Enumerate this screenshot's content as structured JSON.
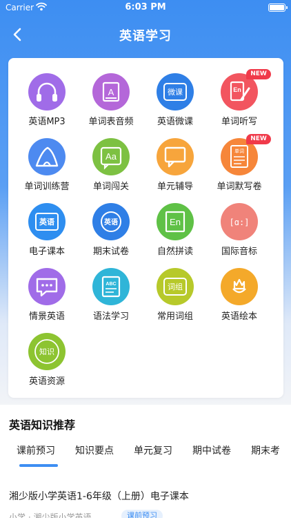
{
  "status_bar": {
    "carrier": "Carrier",
    "time": "6:03 PM"
  },
  "nav": {
    "title": "英语学习"
  },
  "features": [
    {
      "label": "英语MP3",
      "icon": "headphones-icon",
      "color": "#a06ce8",
      "badge": ""
    },
    {
      "label": "单词表音频",
      "icon": "letter-a-book-icon",
      "color": "#b467d9",
      "badge": ""
    },
    {
      "label": "英语微课",
      "icon": "micro-course-icon",
      "color": "#2f7fe6",
      "badge": "",
      "icon_text": "微课"
    },
    {
      "label": "单词听写",
      "icon": "dictation-icon",
      "color": "#f2555f",
      "badge": "NEW"
    },
    {
      "label": "单词训练营",
      "icon": "tent-icon",
      "color": "#4d8af0",
      "badge": ""
    },
    {
      "label": "单词闯关",
      "icon": "aa-icon",
      "color": "#7dc142",
      "badge": "",
      "icon_text": "Aa"
    },
    {
      "label": "单元辅导",
      "icon": "chat-bubble-icon",
      "color": "#f7a53c",
      "badge": ""
    },
    {
      "label": "单词默写卷",
      "icon": "test-paper-icon",
      "color": "#f6863a",
      "badge": "NEW",
      "icon_text": "单词"
    },
    {
      "label": "电子课本",
      "icon": "ebook-icon",
      "color": "#2e8ef0",
      "badge": "",
      "icon_text": "英语"
    },
    {
      "label": "期末试卷",
      "icon": "exam-icon",
      "color": "#2f7fe6",
      "badge": "",
      "icon_text": "英语"
    },
    {
      "label": "自然拼读",
      "icon": "phonics-icon",
      "color": "#5fc146",
      "badge": "",
      "icon_text": "En"
    },
    {
      "label": "国际音标",
      "icon": "phonetic-icon",
      "color": "#f0837a",
      "badge": "",
      "icon_text": "[ɑ:]"
    },
    {
      "label": "情景英语",
      "icon": "dialog-icon",
      "color": "#a06ce8",
      "badge": ""
    },
    {
      "label": "语法学习",
      "icon": "grammar-icon",
      "color": "#2fb5d8",
      "badge": "",
      "icon_text": "ABC"
    },
    {
      "label": "常用词组",
      "icon": "phrase-icon",
      "color": "#b7c92a",
      "badge": "",
      "icon_text": "词组"
    },
    {
      "label": "英语绘本",
      "icon": "picture-book-icon",
      "color": "#f4a92a",
      "badge": ""
    },
    {
      "label": "英语资源",
      "icon": "knowledge-icon",
      "color": "#8dc431",
      "badge": "",
      "icon_text": "知识"
    }
  ],
  "recommend": {
    "title": "英语知识推荐",
    "tabs": [
      "课前预习",
      "知识要点",
      "单元复习",
      "期中试卷",
      "期末考"
    ],
    "active_tab": "课前预习",
    "item_title": "湘少版小学英语1-6年级（上册）电子课本",
    "item_sub": "小学 · 湘少版小学英语",
    "item_tag": "课前预习"
  },
  "colors": {
    "accent": "#3d8ef2",
    "badge": "#f03a4a"
  }
}
